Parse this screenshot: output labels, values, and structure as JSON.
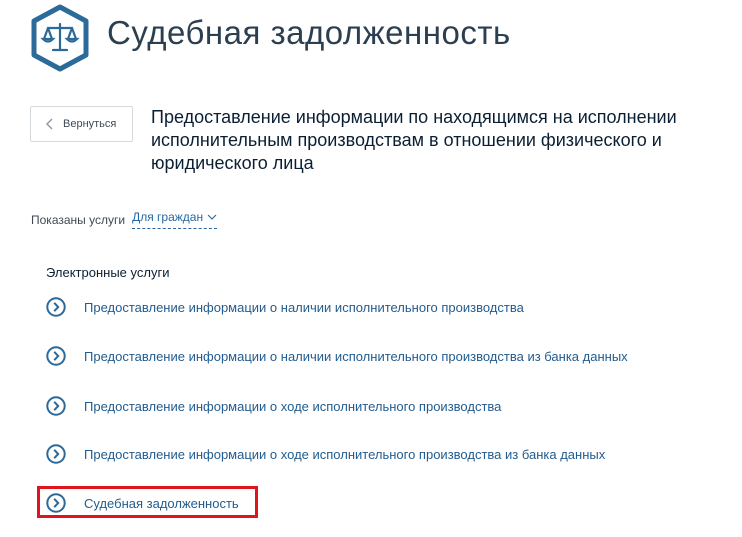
{
  "header": {
    "title": "Судебная задолженность",
    "logo_icon": "scales-of-justice-icon",
    "accent_color": "#2c6a9a"
  },
  "back_button": {
    "label": "Вернуться",
    "icon": "chevron-left-icon"
  },
  "page_heading": "Предоставление информации по находящимся на исполнении исполнительным производствам в отношении физического и юридического лица",
  "filter": {
    "prefix": "Показаны услуги",
    "selected": "Для граждан",
    "icon": "chevron-down-icon"
  },
  "section": {
    "title": "Электронные услуги",
    "items": [
      {
        "label": "Предоставление информации о наличии исполнительного производства"
      },
      {
        "label": "Предоставление информации о наличии исполнительного производства из банка данных"
      },
      {
        "label": "Предоставление информации о ходе исполнительного производства"
      },
      {
        "label": "Предоставление информации о ходе исполнительного производства из банка данных"
      },
      {
        "label": "Судебная задолженность",
        "highlighted": true
      }
    ]
  },
  "colors": {
    "link": "#235c8f",
    "highlight": "#e0141c",
    "icon_stroke": "#2c6a9a"
  }
}
